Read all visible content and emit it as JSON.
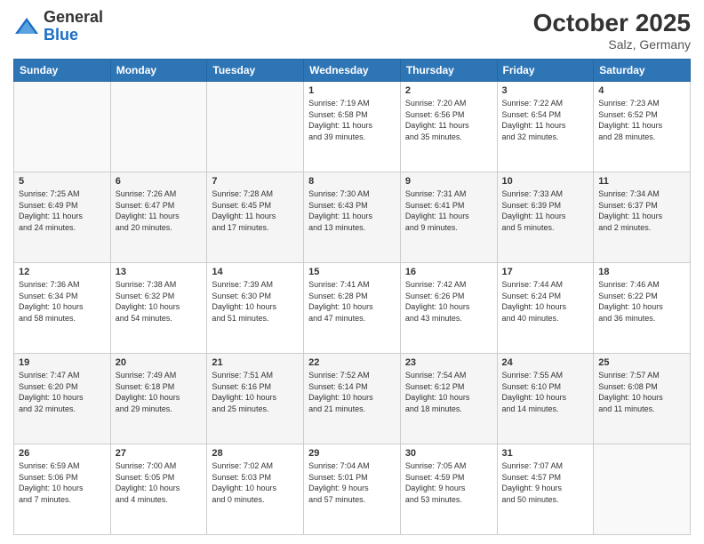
{
  "header": {
    "logo_general": "General",
    "logo_blue": "Blue",
    "title": "October 2025",
    "subtitle": "Salz, Germany"
  },
  "days_of_week": [
    "Sunday",
    "Monday",
    "Tuesday",
    "Wednesday",
    "Thursday",
    "Friday",
    "Saturday"
  ],
  "weeks": [
    [
      {
        "day": "",
        "info": ""
      },
      {
        "day": "",
        "info": ""
      },
      {
        "day": "",
        "info": ""
      },
      {
        "day": "1",
        "info": "Sunrise: 7:19 AM\nSunset: 6:58 PM\nDaylight: 11 hours\nand 39 minutes."
      },
      {
        "day": "2",
        "info": "Sunrise: 7:20 AM\nSunset: 6:56 PM\nDaylight: 11 hours\nand 35 minutes."
      },
      {
        "day": "3",
        "info": "Sunrise: 7:22 AM\nSunset: 6:54 PM\nDaylight: 11 hours\nand 32 minutes."
      },
      {
        "day": "4",
        "info": "Sunrise: 7:23 AM\nSunset: 6:52 PM\nDaylight: 11 hours\nand 28 minutes."
      }
    ],
    [
      {
        "day": "5",
        "info": "Sunrise: 7:25 AM\nSunset: 6:49 PM\nDaylight: 11 hours\nand 24 minutes."
      },
      {
        "day": "6",
        "info": "Sunrise: 7:26 AM\nSunset: 6:47 PM\nDaylight: 11 hours\nand 20 minutes."
      },
      {
        "day": "7",
        "info": "Sunrise: 7:28 AM\nSunset: 6:45 PM\nDaylight: 11 hours\nand 17 minutes."
      },
      {
        "day": "8",
        "info": "Sunrise: 7:30 AM\nSunset: 6:43 PM\nDaylight: 11 hours\nand 13 minutes."
      },
      {
        "day": "9",
        "info": "Sunrise: 7:31 AM\nSunset: 6:41 PM\nDaylight: 11 hours\nand 9 minutes."
      },
      {
        "day": "10",
        "info": "Sunrise: 7:33 AM\nSunset: 6:39 PM\nDaylight: 11 hours\nand 5 minutes."
      },
      {
        "day": "11",
        "info": "Sunrise: 7:34 AM\nSunset: 6:37 PM\nDaylight: 11 hours\nand 2 minutes."
      }
    ],
    [
      {
        "day": "12",
        "info": "Sunrise: 7:36 AM\nSunset: 6:34 PM\nDaylight: 10 hours\nand 58 minutes."
      },
      {
        "day": "13",
        "info": "Sunrise: 7:38 AM\nSunset: 6:32 PM\nDaylight: 10 hours\nand 54 minutes."
      },
      {
        "day": "14",
        "info": "Sunrise: 7:39 AM\nSunset: 6:30 PM\nDaylight: 10 hours\nand 51 minutes."
      },
      {
        "day": "15",
        "info": "Sunrise: 7:41 AM\nSunset: 6:28 PM\nDaylight: 10 hours\nand 47 minutes."
      },
      {
        "day": "16",
        "info": "Sunrise: 7:42 AM\nSunset: 6:26 PM\nDaylight: 10 hours\nand 43 minutes."
      },
      {
        "day": "17",
        "info": "Sunrise: 7:44 AM\nSunset: 6:24 PM\nDaylight: 10 hours\nand 40 minutes."
      },
      {
        "day": "18",
        "info": "Sunrise: 7:46 AM\nSunset: 6:22 PM\nDaylight: 10 hours\nand 36 minutes."
      }
    ],
    [
      {
        "day": "19",
        "info": "Sunrise: 7:47 AM\nSunset: 6:20 PM\nDaylight: 10 hours\nand 32 minutes."
      },
      {
        "day": "20",
        "info": "Sunrise: 7:49 AM\nSunset: 6:18 PM\nDaylight: 10 hours\nand 29 minutes."
      },
      {
        "day": "21",
        "info": "Sunrise: 7:51 AM\nSunset: 6:16 PM\nDaylight: 10 hours\nand 25 minutes."
      },
      {
        "day": "22",
        "info": "Sunrise: 7:52 AM\nSunset: 6:14 PM\nDaylight: 10 hours\nand 21 minutes."
      },
      {
        "day": "23",
        "info": "Sunrise: 7:54 AM\nSunset: 6:12 PM\nDaylight: 10 hours\nand 18 minutes."
      },
      {
        "day": "24",
        "info": "Sunrise: 7:55 AM\nSunset: 6:10 PM\nDaylight: 10 hours\nand 14 minutes."
      },
      {
        "day": "25",
        "info": "Sunrise: 7:57 AM\nSunset: 6:08 PM\nDaylight: 10 hours\nand 11 minutes."
      }
    ],
    [
      {
        "day": "26",
        "info": "Sunrise: 6:59 AM\nSunset: 5:06 PM\nDaylight: 10 hours\nand 7 minutes."
      },
      {
        "day": "27",
        "info": "Sunrise: 7:00 AM\nSunset: 5:05 PM\nDaylight: 10 hours\nand 4 minutes."
      },
      {
        "day": "28",
        "info": "Sunrise: 7:02 AM\nSunset: 5:03 PM\nDaylight: 10 hours\nand 0 minutes."
      },
      {
        "day": "29",
        "info": "Sunrise: 7:04 AM\nSunset: 5:01 PM\nDaylight: 9 hours\nand 57 minutes."
      },
      {
        "day": "30",
        "info": "Sunrise: 7:05 AM\nSunset: 4:59 PM\nDaylight: 9 hours\nand 53 minutes."
      },
      {
        "day": "31",
        "info": "Sunrise: 7:07 AM\nSunset: 4:57 PM\nDaylight: 9 hours\nand 50 minutes."
      },
      {
        "day": "",
        "info": ""
      }
    ]
  ]
}
